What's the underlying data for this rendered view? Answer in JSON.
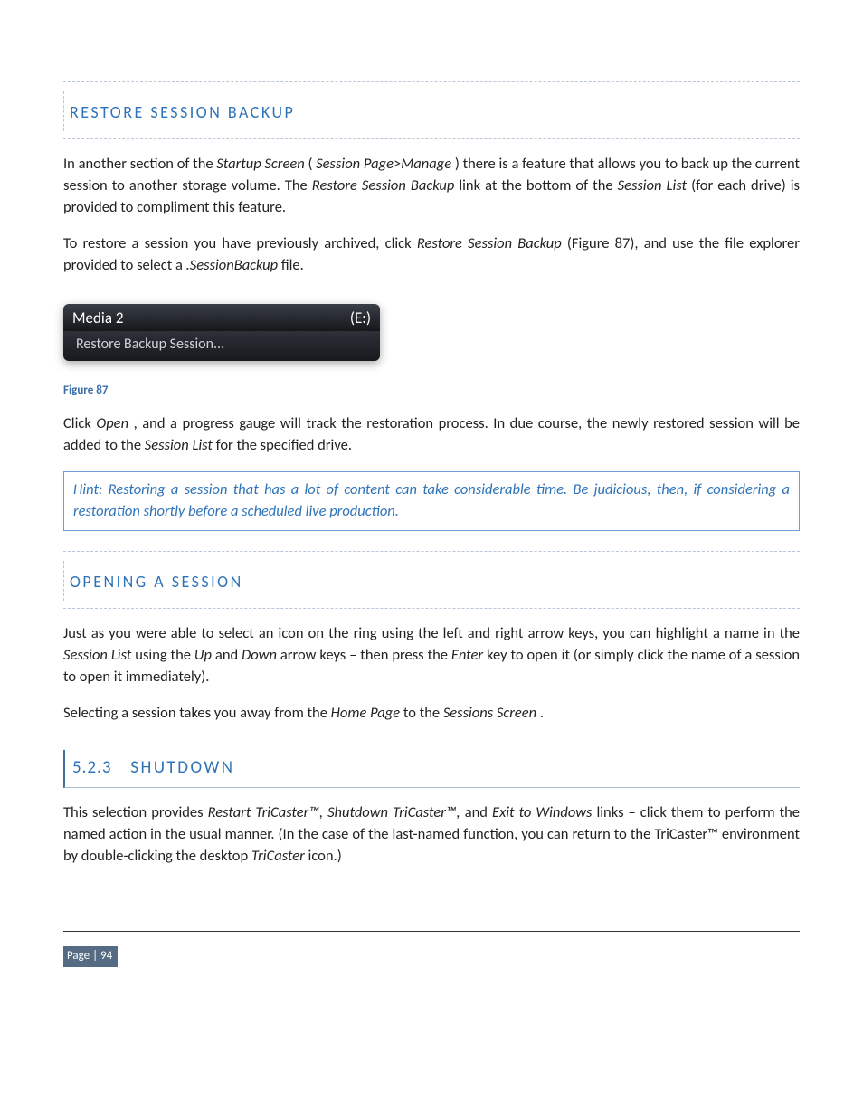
{
  "sections": {
    "restore_heading": "RESTORE SESSION BACKUP",
    "opening_heading": "OPENING A SESSION",
    "shutdown": {
      "number": "5.2.3",
      "title": "SHUTDOWN"
    }
  },
  "paragraphs": {
    "restore_p1_a": "In another section of the ",
    "restore_p1_b": " (",
    "restore_p1_c": ") there is a feature that allows you to back up the current session to another storage volume.  The ",
    "restore_p1_d": " link at the bottom of the ",
    "restore_p1_e": " (for each drive) is provided to compliment this feature.",
    "restore_p2_a": "To restore a session you have previously archived, click ",
    "restore_p2_b": " (Figure 87), and use the file explorer provided to select a ",
    "restore_p2_c": " file.",
    "restore_p3_a": "Click ",
    "restore_p3_b": ", and a progress gauge will track the restoration process.  In due course, the newly restored session will be added to the ",
    "restore_p3_c": " for the specified drive.",
    "hint": "Hint: Restoring a session that has a lot of content can take considerable time.  Be judicious, then, if considering a restoration shortly before a scheduled live production.",
    "opening_p1_a": "Just as you were able to select an icon on the ring using the left and right arrow keys, you can highlight a name in the ",
    "opening_p1_b": " using the ",
    "opening_p1_c": " and ",
    "opening_p1_d": " arrow keys – then press the ",
    "opening_p1_e": " key to open it (or simply click the name of a session to open it immediately).",
    "opening_p2_a": " Selecting a session takes you away from the ",
    "opening_p2_b": " to the ",
    "opening_p2_c": ".",
    "shutdown_p1_a": "This selection provides ",
    "shutdown_p1_b": " and ",
    "shutdown_p1_c": " links – click them to perform the named action in the usual manner.  (In the case of the last-named function, you can return to the TriCaster™ environment by double-clicking the desktop ",
    "shutdown_p1_d": " icon.)"
  },
  "italics": {
    "startup_screen": "Startup Screen",
    "session_page_manage": "Session Page>Manage",
    "restore_session_backup": "Restore Session Backup",
    "session_list": "Session List",
    "dot_sessionbackup": ".SessionBackup",
    "open": "Open",
    "up": "Up",
    "down": "Down",
    "enter": "Enter",
    "home_page": "Home Page",
    "sessions_screen": "Sessions Screen",
    "restart_shutdown": "Restart TriCaster™, Shutdown TriCaster™,",
    "exit_to_windows": "Exit to Windows",
    "tricaster": "TriCaster"
  },
  "figure": {
    "row1_left": "Media 2",
    "row1_right": "(E:)",
    "row2": "Restore Backup Session...",
    "caption": "Figure 87"
  },
  "footer": {
    "page_label": "Page",
    "page_number": "94"
  }
}
